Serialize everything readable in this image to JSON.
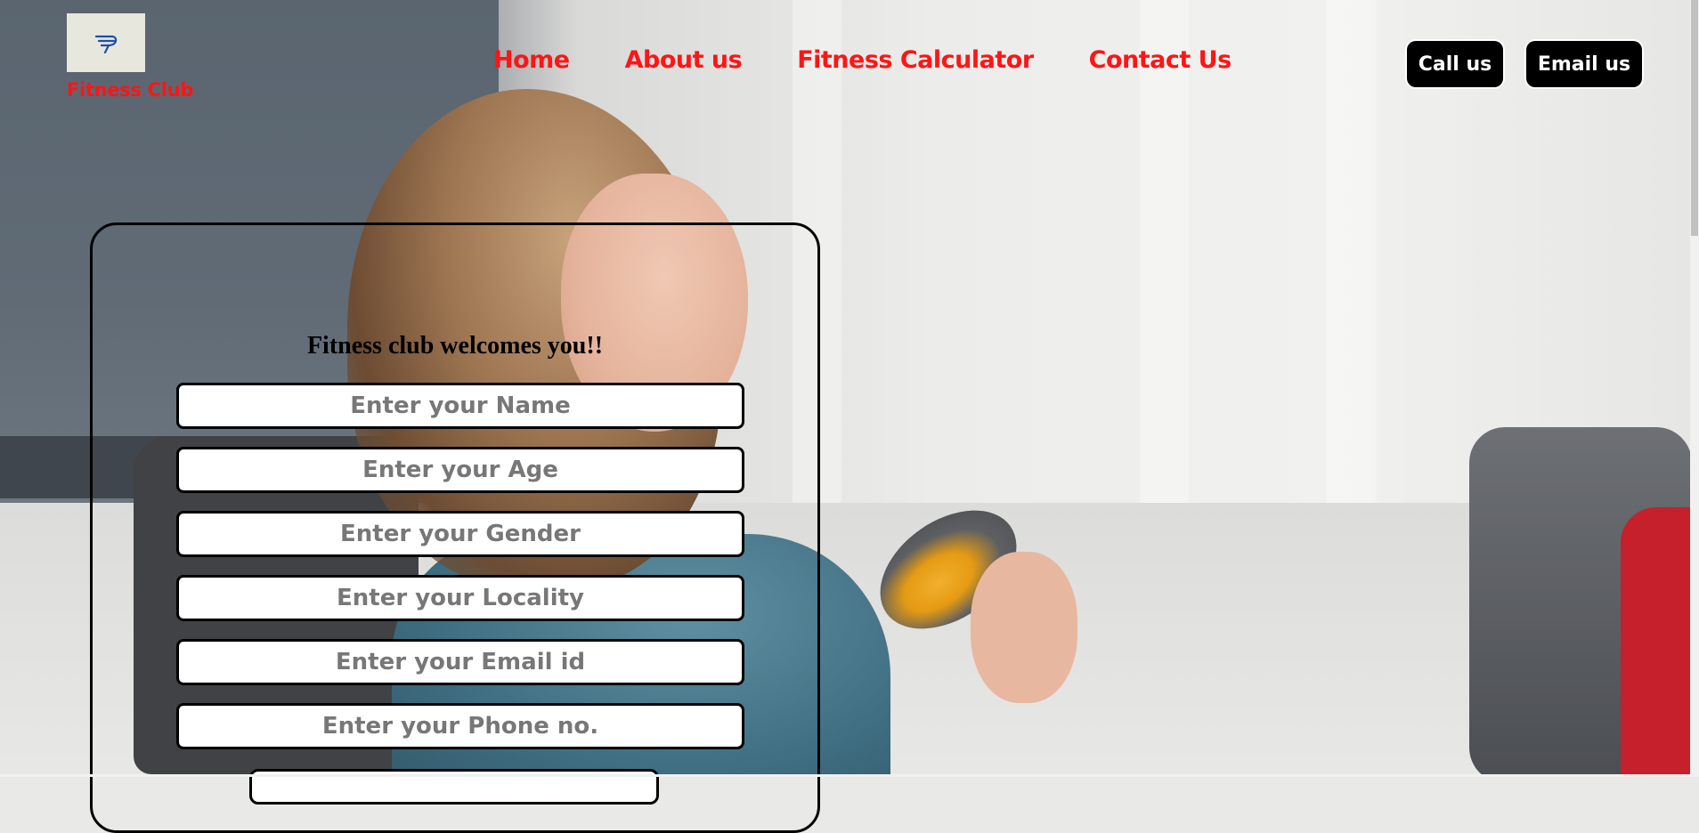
{
  "brand": {
    "name": "Fitness Club",
    "logo_icon": "fitness-logo-icon"
  },
  "nav": {
    "items": [
      {
        "label": "Home"
      },
      {
        "label": "About us"
      },
      {
        "label": "Fitness Calculator"
      },
      {
        "label": "Contact Us"
      }
    ]
  },
  "actions": {
    "call_label": "Call us",
    "email_label": "Email us"
  },
  "form": {
    "heading": "Fitness club welcomes you!!",
    "fields": [
      {
        "placeholder": "Enter your Name",
        "value": ""
      },
      {
        "placeholder": "Enter your Age",
        "value": ""
      },
      {
        "placeholder": "Enter your Gender",
        "value": ""
      },
      {
        "placeholder": "Enter your Locality",
        "value": ""
      },
      {
        "placeholder": "Enter your Email id",
        "value": ""
      },
      {
        "placeholder": "Enter your Phone no.",
        "value": ""
      }
    ]
  },
  "colors": {
    "accent": "#ff1515",
    "button_bg": "#000000",
    "button_text": "#ffffff"
  }
}
